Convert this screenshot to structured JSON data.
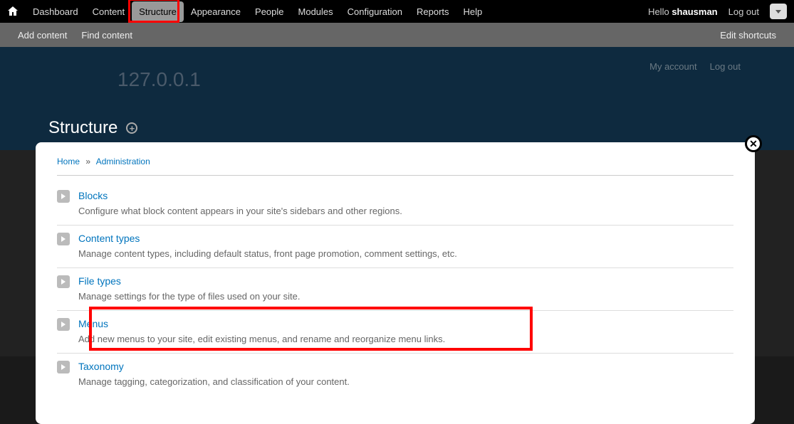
{
  "toolbar": {
    "items": [
      {
        "label": "Dashboard",
        "active": false
      },
      {
        "label": "Content",
        "active": false
      },
      {
        "label": "Structure",
        "active": true
      },
      {
        "label": "Appearance",
        "active": false
      },
      {
        "label": "People",
        "active": false
      },
      {
        "label": "Modules",
        "active": false
      },
      {
        "label": "Configuration",
        "active": false
      },
      {
        "label": "Reports",
        "active": false
      },
      {
        "label": "Help",
        "active": false
      }
    ],
    "hello_prefix": "Hello ",
    "username": "shausman",
    "logout": "Log out"
  },
  "shortcuts": {
    "items": [
      {
        "label": "Add content"
      },
      {
        "label": "Find content"
      }
    ],
    "edit": "Edit shortcuts"
  },
  "background": {
    "ip": "127.0.0.1",
    "my_account": "My account",
    "logout": "Log out"
  },
  "overlay": {
    "title": "Structure",
    "breadcrumb": {
      "home": "Home",
      "admin": "Administration"
    },
    "items": [
      {
        "title": "Blocks",
        "desc": "Configure what block content appears in your site's sidebars and other regions."
      },
      {
        "title": "Content types",
        "desc": "Manage content types, including default status, front page promotion, comment settings, etc."
      },
      {
        "title": "File types",
        "desc": "Manage settings for the type of files used on your site."
      },
      {
        "title": "Menus",
        "desc": "Add new menus to your site, edit existing menus, and rename and reorganize menu links."
      },
      {
        "title": "Taxonomy",
        "desc": "Manage tagging, categorization, and classification of your content."
      }
    ]
  }
}
